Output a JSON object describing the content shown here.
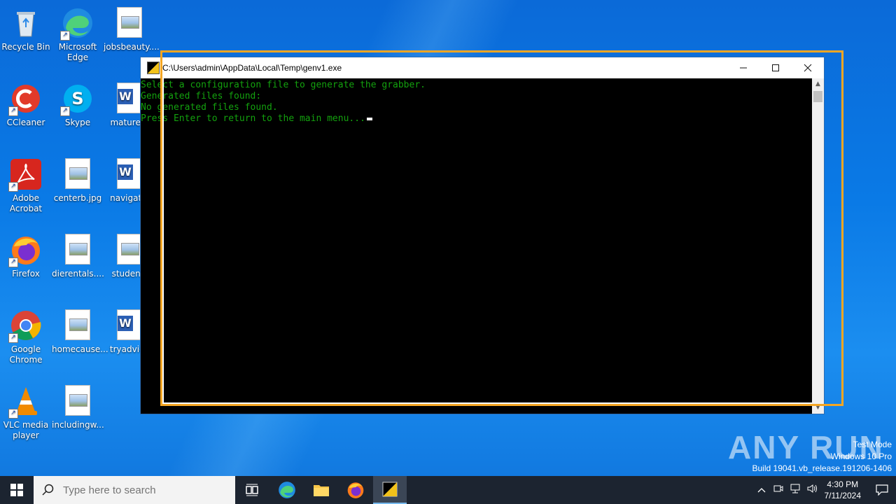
{
  "desktop": {
    "icons": [
      {
        "label": "Recycle Bin"
      },
      {
        "label": "Microsoft Edge"
      },
      {
        "label": "jobsbeauty...."
      },
      {
        "label": "CCleaner"
      },
      {
        "label": "Skype"
      },
      {
        "label": "maturem"
      },
      {
        "label": "Adobe Acrobat"
      },
      {
        "label": "centerb.jpg"
      },
      {
        "label": "navigatio"
      },
      {
        "label": "Firefox"
      },
      {
        "label": "dierentals...."
      },
      {
        "label": "studentr"
      },
      {
        "label": "Google Chrome"
      },
      {
        "label": "homecause..."
      },
      {
        "label": "tryadvice"
      },
      {
        "label": "VLC media player"
      },
      {
        "label": "includingw..."
      }
    ]
  },
  "console": {
    "title": "C:\\Users\\admin\\AppData\\Local\\Temp\\genv1.exe",
    "lines": [
      "Select a configuration file to generate the grabber.",
      "Generated files found:",
      "No generated files found.",
      "Press Enter to return to the main menu..."
    ],
    "text_color": "#13a10e"
  },
  "watermark": {
    "logo": "ANY RUN",
    "line1": "Test Mode",
    "line2": "Windows 10 Pro",
    "line3": "Build 19041.vb_release.191206-1406"
  },
  "taskbar": {
    "search_placeholder": "Type here to search",
    "time": "4:30 PM",
    "date": "7/11/2024"
  },
  "colors": {
    "highlight": "#f5a623",
    "taskbar_bg": "#1c2430"
  }
}
